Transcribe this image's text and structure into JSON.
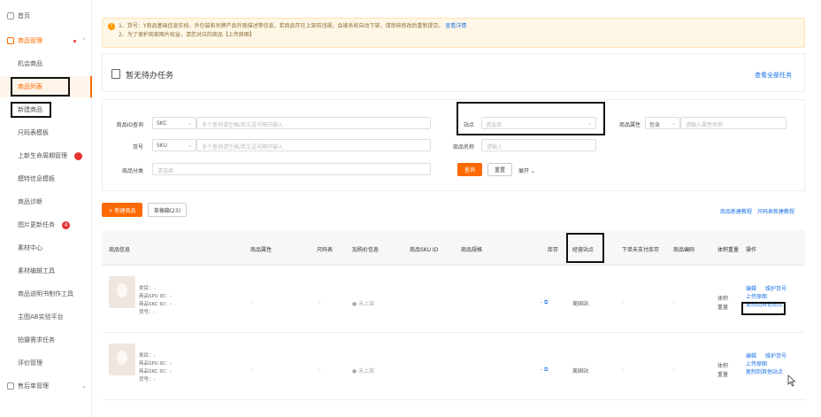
{
  "sidebar": {
    "items": [
      {
        "label": "首页"
      },
      {
        "label": "商品管理"
      },
      {
        "label": "机会商品"
      },
      {
        "label": "商品列表"
      },
      {
        "label": "新建商品"
      },
      {
        "label": "尺码表模板"
      },
      {
        "label": "上新生命周期管理"
      },
      {
        "label": "模特信息模板"
      },
      {
        "label": "商品诊断"
      },
      {
        "label": "图片更新任务"
      },
      {
        "label": "素材中心"
      },
      {
        "label": "素材编辑工具"
      },
      {
        "label": "商品说明书制作工具"
      },
      {
        "label": "主图AB实验平台"
      },
      {
        "label": "拍摄需求任务"
      },
      {
        "label": "评价管理"
      },
      {
        "label": "售后单管理"
      }
    ],
    "badge_6": "",
    "badge_9": "4"
  },
  "notice": {
    "line1": "1、货号：Y商品基础信息实拍、外包装和吊牌产品外观描述等信息，若商品存在上架前违规，会被系统自动下架，请审核修改后重新提交。",
    "line1_link": "查看详情",
    "line2": "2、为了保护商家图片权益，请您对应的商品【上传原图】"
  },
  "task": {
    "title": "暂无待办任务",
    "link": "查看全部任务"
  },
  "filters": {
    "id_query_label": "商品ID查询",
    "id_query_type": "SKC",
    "id_query_placeholder": "多个查询请空格/英文逗号隔开输入",
    "sku_label": "货号",
    "sku_type": "SKU",
    "sku_placeholder": "多个查询请空格/英文逗号隔开输入",
    "category_label": "商品分类",
    "category_placeholder": "请选择",
    "site_label": "站点",
    "site_placeholder": "请选择",
    "name_label": "商品名称",
    "name_placeholder": "请输入",
    "attr_label": "商品属性",
    "attr_type": "包含",
    "attr_placeholder": "请输入属性名称",
    "search_btn": "查询",
    "reset_btn": "重置",
    "expand": "展开 ⌄"
  },
  "actions": {
    "new_product": "+ 新建商品",
    "draft_box": "草稿箱(23)",
    "right_link_1": "商品新建教程",
    "right_link_2": "尺码表新建教程"
  },
  "table": {
    "columns": [
      "商品信息",
      "商品属性",
      "尺码表",
      "加购价信息",
      "商品SKU ID",
      "商品规格",
      "库存",
      "经营站点",
      "下单未支付库存",
      "商品编码",
      "体积重量",
      "操作"
    ],
    "rows": [
      {
        "info_lines": [
          "类目：-",
          "商品SPU ID：-",
          "商品SKC ID：-",
          "货号：-"
        ],
        "attr": "-",
        "size": "-",
        "price": "● 未上架",
        "stock": "- ⧉",
        "site": "美国站",
        "unpaid": "-",
        "code": "-",
        "weight_1": "体积",
        "weight_2": "重量",
        "op_edit": "编辑",
        "op_maint": "维护货号",
        "op_upload": "上传原图",
        "op_copy": "复制到其他站点"
      },
      {
        "info_lines": [
          "类目：-",
          "商品SPU ID：-",
          "商品SKC ID：-",
          "货号：-"
        ],
        "attr": "-",
        "size": "-",
        "price": "● 未上架",
        "stock": "- ⧉",
        "site": "美国站",
        "unpaid": "-",
        "code": "-",
        "weight_1": "体积",
        "weight_2": "重量",
        "op_edit": "编辑",
        "op_maint": "维护货号",
        "op_upload": "上传原图",
        "op_copy": "复制到其他站点"
      }
    ]
  },
  "colors": {
    "accent": "#ff6a00",
    "link": "#1a73e8",
    "notice_bg": "#fff7e6",
    "badge": "#e83232"
  }
}
